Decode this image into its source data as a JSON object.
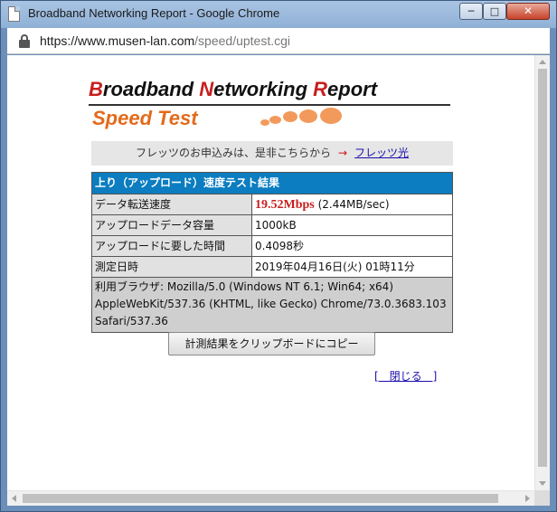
{
  "window": {
    "title": "Broadband Networking Report - Google Chrome",
    "minimize_label": "─",
    "maximize_label": "□",
    "close_label": "✕"
  },
  "address": {
    "host": "https://www.musen-lan.com",
    "path": "/speed/uptest.cgi"
  },
  "logo": {
    "words": [
      {
        "cap": "B",
        "rest": "roadband "
      },
      {
        "cap": "N",
        "rest": "etworking "
      },
      {
        "cap": "R",
        "rest": "eport"
      }
    ],
    "subtitle": "Speed Test"
  },
  "notice": {
    "text": "フレッツのお申込みは、是非こちらから",
    "arrow": "→",
    "link": "フレッツ光"
  },
  "result": {
    "header": "上り（アップロード）速度テスト結果",
    "speed_label": "データ転送速度",
    "speed_value": "19.52Mbps",
    "speed_alt": "(2.44MB/sec)",
    "rows": [
      {
        "label": "アップロードデータ容量",
        "value": "1000kB"
      },
      {
        "label": "アップロードに要した時間",
        "value": "0.4098秒"
      },
      {
        "label": "測定日時",
        "value": "2019年04月16日(火) 01時11分"
      }
    ],
    "browser_text": "利用ブラウザ: Mozilla/5.0 (Windows NT 6.1; Win64; x64) AppleWebKit/537.36 (KHTML, like Gecko) Chrome/73.0.3683.103 Safari/537.36"
  },
  "actions": {
    "copy_button": "計測結果をクリップボードにコピー",
    "close_link": "[　閉じる　]"
  },
  "colors": {
    "header_bg": "#0b7dc0",
    "speed_value": "#c81e1e",
    "logo_subtitle": "#e36a1a"
  }
}
